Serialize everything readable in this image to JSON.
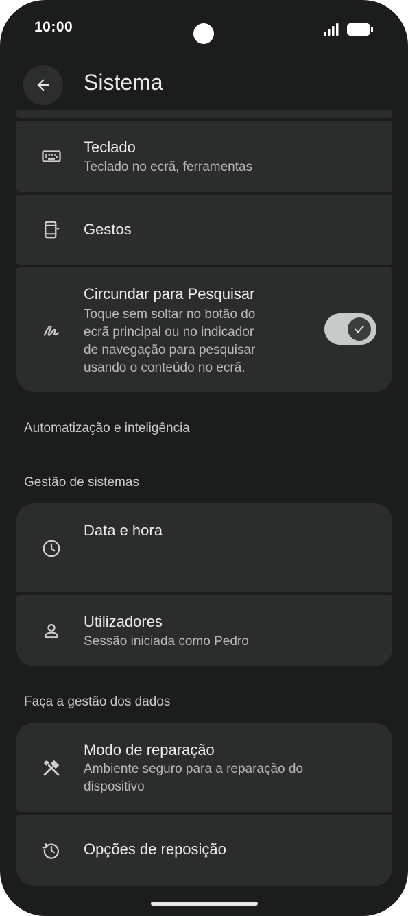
{
  "status_bar": {
    "time": "10:00"
  },
  "app_bar": {
    "title": "Sistema"
  },
  "items": {
    "keyboard": {
      "title": "Teclado",
      "subtitle": "Teclado no ecrã, ferramentas"
    },
    "gestures": {
      "title": "Gestos"
    },
    "circle_to_search": {
      "title": "Circundar para Pesquisar",
      "subtitle_lines": [
        "Toque sem soltar no botão do",
        "ecrã principal ou no indicador",
        "de navegação para pesquisar",
        "usando o conteúdo no ecrã."
      ],
      "toggle_on": true
    },
    "date_time": {
      "title": "Data e hora"
    },
    "users": {
      "title": "Utilizadores",
      "subtitle": "Sessão iniciada como Pedro"
    },
    "repair_mode": {
      "title": "Modo de reparação",
      "subtitle_lines": [
        "Ambiente seguro para a reparação do",
        "dispositivo"
      ]
    },
    "reset": {
      "title": "Opções de reposição"
    }
  },
  "sections": {
    "automation": "Automatização e inteligência",
    "system_management": "Gestão de sistemas",
    "data_management": "Faça a gestão dos dados"
  },
  "icons": {
    "back": "arrow-left-icon",
    "keyboard": "keyboard-icon",
    "gestures": "phone-gesture-icon",
    "circle_to_search": "scribble-icon",
    "date_time": "clock-icon",
    "users": "person-icon",
    "repair_mode": "tools-icon",
    "reset": "history-icon"
  },
  "colors": {
    "background": "#1b1c1c",
    "card": "#2b2c2c",
    "toggle_track": "#c5cbc8",
    "toggle_thumb": "#3a3f3d"
  }
}
